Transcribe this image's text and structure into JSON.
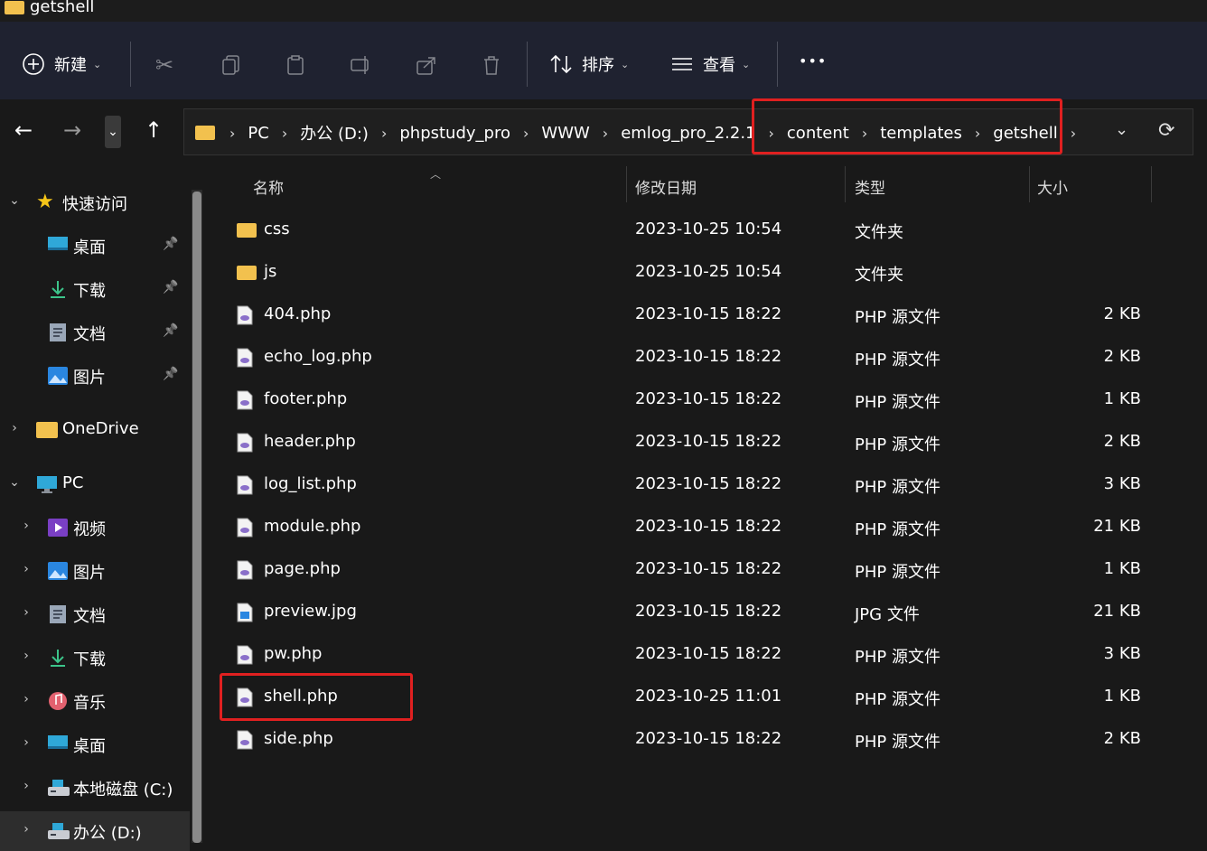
{
  "window": {
    "title": "getshell"
  },
  "ribbon": {
    "new_label": "新建",
    "sort_label": "排序",
    "view_label": "查看",
    "more_label": "•••"
  },
  "nav": {
    "breadcrumbs": [
      "PC",
      "办公 (D:)",
      "phpstudy_pro",
      "WWW",
      "emlog_pro_2.2.1",
      "content",
      "templates",
      "getshell"
    ]
  },
  "sidebar": {
    "quick_access": "快速访问",
    "pinned": [
      {
        "label": "桌面",
        "icon": "desktop-icon"
      },
      {
        "label": "下载",
        "icon": "download-icon"
      },
      {
        "label": "文档",
        "icon": "document-icon"
      },
      {
        "label": "图片",
        "icon": "pictures-icon"
      }
    ],
    "onedrive": "OneDrive",
    "pc": "PC",
    "pc_items": [
      {
        "label": "视频",
        "icon": "video-icon"
      },
      {
        "label": "图片",
        "icon": "pictures-icon"
      },
      {
        "label": "文档",
        "icon": "document-icon"
      },
      {
        "label": "下载",
        "icon": "download-icon"
      },
      {
        "label": "音乐",
        "icon": "music-icon"
      },
      {
        "label": "桌面",
        "icon": "desktop-icon"
      },
      {
        "label": "本地磁盘 (C:)",
        "icon": "drive-icon"
      },
      {
        "label": "办公 (D:)",
        "icon": "drive-icon"
      }
    ]
  },
  "columns": {
    "name": "名称",
    "date": "修改日期",
    "type": "类型",
    "size": "大小"
  },
  "files": [
    {
      "name": "css",
      "date": "2023-10-25 10:54",
      "type": "文件夹",
      "size": "",
      "kind": "folder"
    },
    {
      "name": "js",
      "date": "2023-10-25 10:54",
      "type": "文件夹",
      "size": "",
      "kind": "folder"
    },
    {
      "name": "404.php",
      "date": "2023-10-15 18:22",
      "type": "PHP 源文件",
      "size": "2 KB",
      "kind": "php"
    },
    {
      "name": "echo_log.php",
      "date": "2023-10-15 18:22",
      "type": "PHP 源文件",
      "size": "2 KB",
      "kind": "php"
    },
    {
      "name": "footer.php",
      "date": "2023-10-15 18:22",
      "type": "PHP 源文件",
      "size": "1 KB",
      "kind": "php"
    },
    {
      "name": "header.php",
      "date": "2023-10-15 18:22",
      "type": "PHP 源文件",
      "size": "2 KB",
      "kind": "php"
    },
    {
      "name": "log_list.php",
      "date": "2023-10-15 18:22",
      "type": "PHP 源文件",
      "size": "3 KB",
      "kind": "php"
    },
    {
      "name": "module.php",
      "date": "2023-10-15 18:22",
      "type": "PHP 源文件",
      "size": "21 KB",
      "kind": "php"
    },
    {
      "name": "page.php",
      "date": "2023-10-15 18:22",
      "type": "PHP 源文件",
      "size": "1 KB",
      "kind": "php"
    },
    {
      "name": "preview.jpg",
      "date": "2023-10-15 18:22",
      "type": "JPG 文件",
      "size": "21 KB",
      "kind": "jpg"
    },
    {
      "name": "pw.php",
      "date": "2023-10-15 18:22",
      "type": "PHP 源文件",
      "size": "3 KB",
      "kind": "php"
    },
    {
      "name": "shell.php",
      "date": "2023-10-25 11:01",
      "type": "PHP 源文件",
      "size": "1 KB",
      "kind": "php"
    },
    {
      "name": "side.php",
      "date": "2023-10-15 18:22",
      "type": "PHP 源文件",
      "size": "2 KB",
      "kind": "php"
    }
  ],
  "colors": {
    "highlight": "#e02020",
    "folder": "#f2c14e",
    "background": "#191919"
  }
}
